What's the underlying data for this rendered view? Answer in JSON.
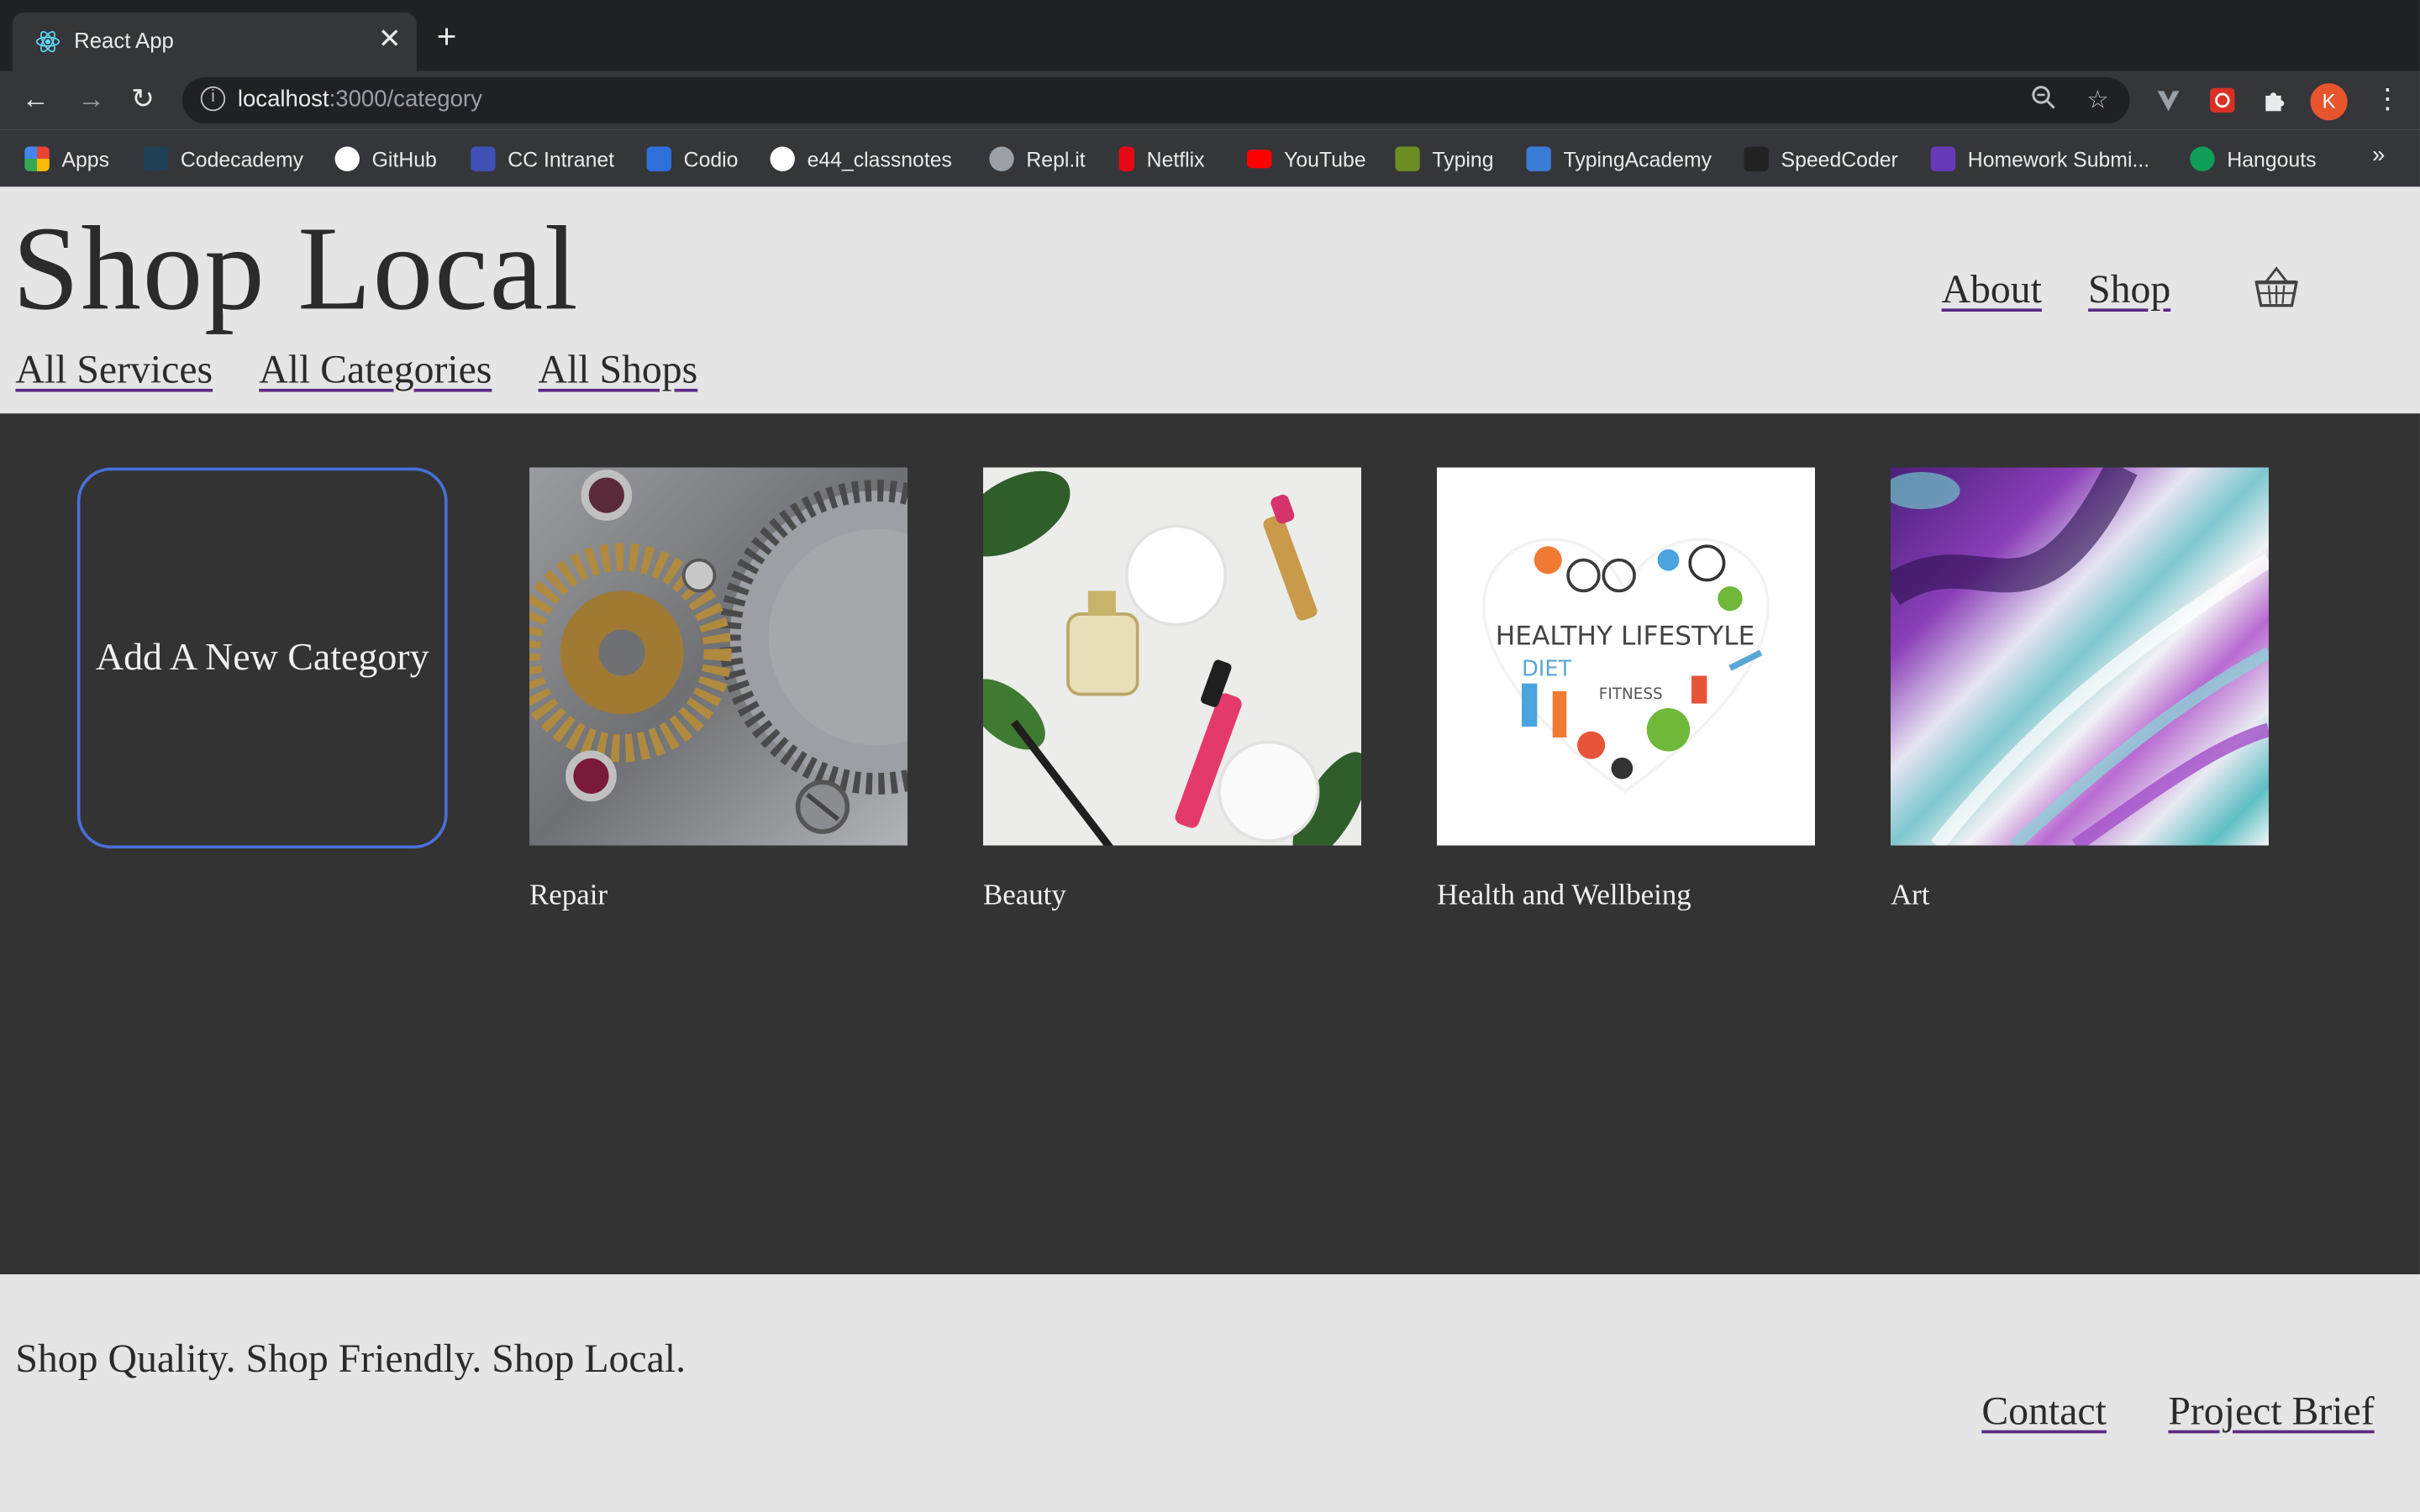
{
  "browser": {
    "tab_title": "React App",
    "url_host": "localhost",
    "url_path": ":3000/category",
    "profile_initial": "K",
    "bookmarks": [
      {
        "label": "Apps",
        "icon": "apps-grid-icon",
        "color": "#4285f4"
      },
      {
        "label": "Codecademy",
        "icon": "codecademy-icon",
        "color": "#1f4056"
      },
      {
        "label": "GitHub",
        "icon": "github-icon",
        "color": "#ffffff"
      },
      {
        "label": "CC Intranet",
        "icon": "intranet-icon",
        "color": "#3f51b5"
      },
      {
        "label": "Codio",
        "icon": "codio-icon",
        "color": "#2f6fdc"
      },
      {
        "label": "e44_classnotes",
        "icon": "github-icon",
        "color": "#ffffff"
      },
      {
        "label": "Repl.it",
        "icon": "replit-icon",
        "color": "#9aa0a6"
      },
      {
        "label": "Netflix",
        "icon": "netflix-icon",
        "color": "#e50914"
      },
      {
        "label": "YouTube",
        "icon": "youtube-icon",
        "color": "#ff0000"
      },
      {
        "label": "Typing",
        "icon": "typing-icon",
        "color": "#6b8e23"
      },
      {
        "label": "TypingAcademy",
        "icon": "typingacademy-icon",
        "color": "#3a7bd5"
      },
      {
        "label": "SpeedCoder",
        "icon": "speedcoder-icon",
        "color": "#222222"
      },
      {
        "label": "Homework Submi...",
        "icon": "homework-icon",
        "color": "#673ab7"
      },
      {
        "label": "Hangouts",
        "icon": "hangouts-icon",
        "color": "#0f9d58"
      }
    ],
    "bookmarks_more": "»"
  },
  "header": {
    "logo": "Shop Local",
    "subnav": [
      "All Services",
      "All Categories",
      "All Shops"
    ],
    "topnav": [
      "About",
      "Shop"
    ]
  },
  "main": {
    "add_card_label": "Add A New Category",
    "categories": [
      {
        "label": "Repair",
        "image": "watch-gears-image"
      },
      {
        "label": "Beauty",
        "image": "cosmetics-image"
      },
      {
        "label": "Health and Wellbeing",
        "image": "healthy-lifestyle-heart-image"
      },
      {
        "label": "Art",
        "image": "fluid-art-image"
      }
    ]
  },
  "footer": {
    "tagline": "Shop Quality. Shop Friendly. Shop Local.",
    "links": [
      "Contact",
      "Project Brief"
    ]
  }
}
